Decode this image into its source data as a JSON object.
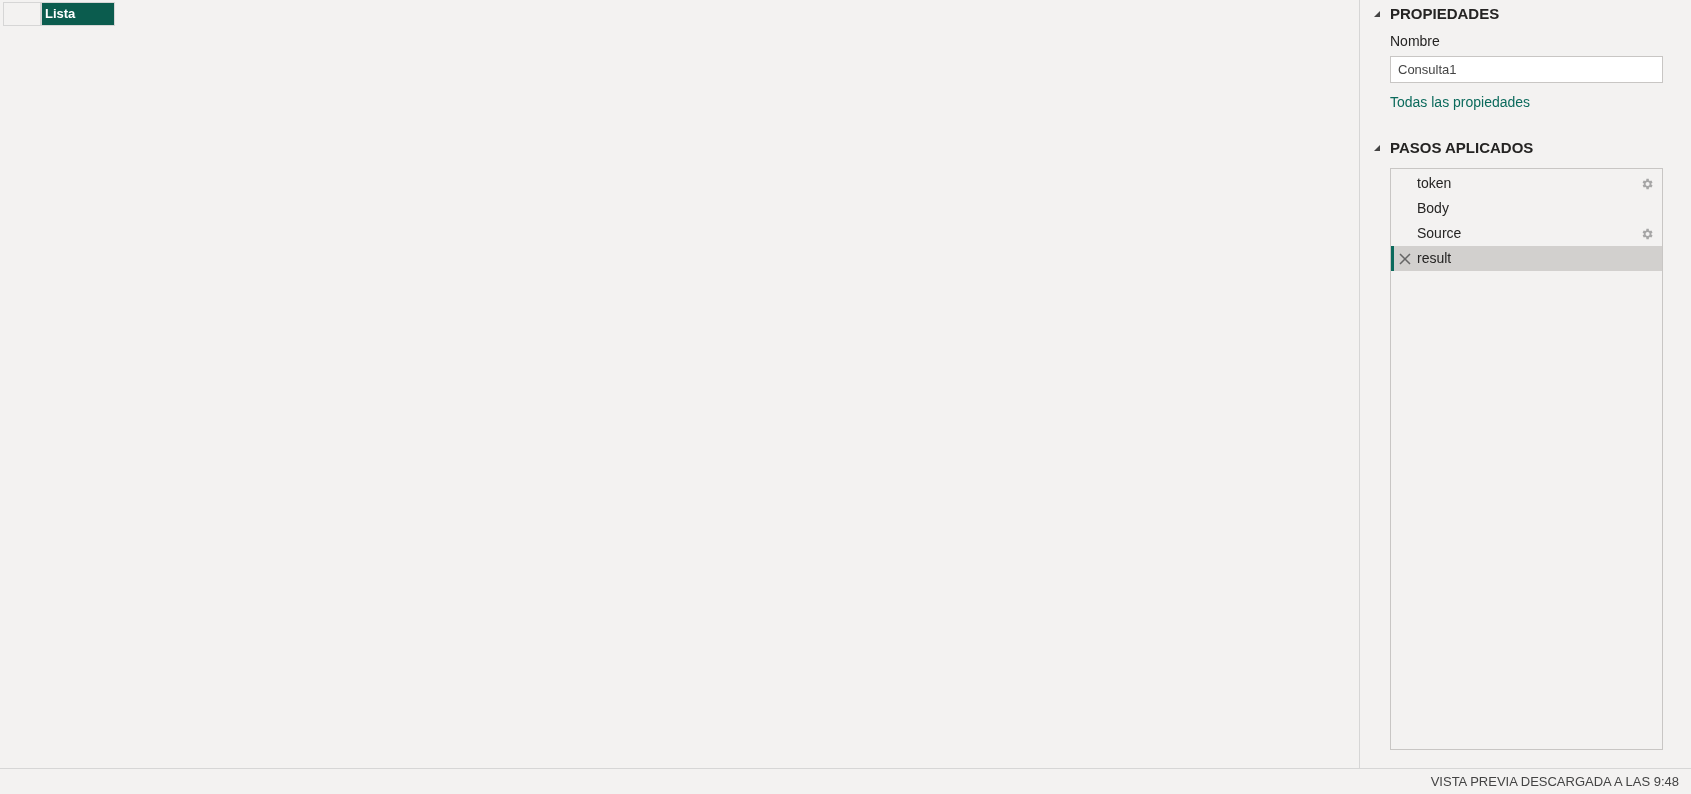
{
  "table": {
    "columns": [
      "Lista"
    ]
  },
  "properties": {
    "title": "PROPIEDADES",
    "expanded": true,
    "name_label": "Nombre",
    "name_value": "Consulta1",
    "all_link": "Todas las propiedades"
  },
  "applied_steps": {
    "title": "PASOS APLICADOS",
    "expanded": true,
    "steps": [
      {
        "label": "token",
        "settings": true,
        "selected": false
      },
      {
        "label": "Body",
        "settings": false,
        "selected": false
      },
      {
        "label": "Source",
        "settings": true,
        "selected": false
      },
      {
        "label": "result",
        "settings": false,
        "selected": true
      }
    ]
  },
  "status_bar": "VISTA PREVIA DESCARGADA A LAS 9:48"
}
